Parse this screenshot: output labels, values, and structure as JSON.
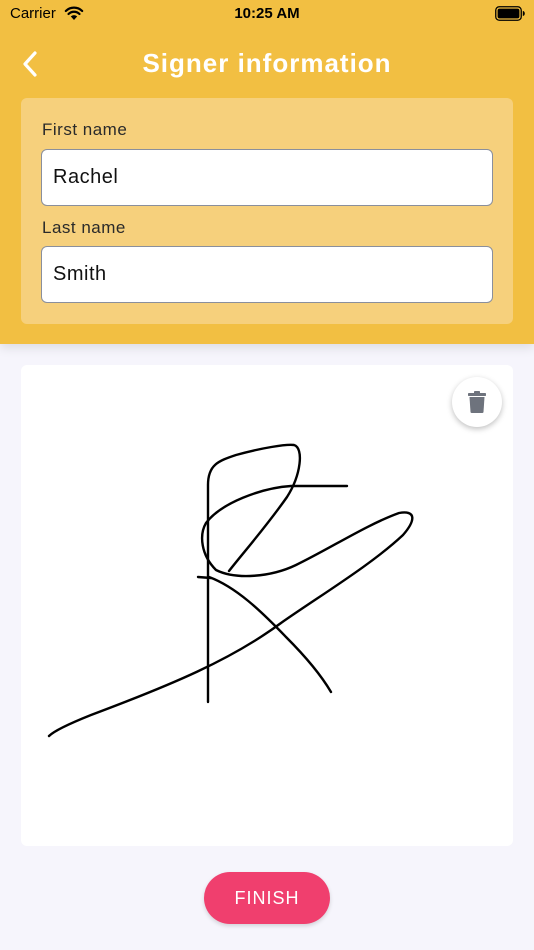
{
  "status_bar": {
    "carrier": "Carrier",
    "time": "10:25 AM"
  },
  "nav": {
    "title": "Signer information",
    "back_icon": "chevron-left-icon"
  },
  "form": {
    "first_name": {
      "label": "First name",
      "value": "Rachel"
    },
    "last_name": {
      "label": "Last name",
      "value": "Smith"
    }
  },
  "signature": {
    "delete_icon": "trash-icon"
  },
  "actions": {
    "finish_label": "FINISH"
  },
  "colors": {
    "header": "#f2bf42",
    "form_card": "#f6d07c",
    "finish_button": "#f03f6e",
    "background": "#f6f5fc"
  }
}
